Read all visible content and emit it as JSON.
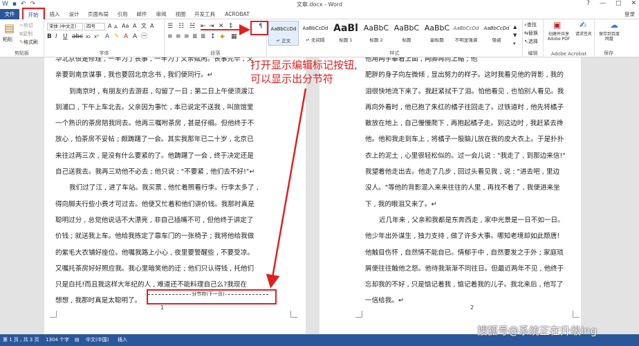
{
  "window": {
    "title": "文章.docx - Word",
    "controls": [
      "?",
      "—",
      "□",
      "✕"
    ]
  },
  "tabs": {
    "file": "文件",
    "items": [
      "开始",
      "插入",
      "设计",
      "页面布局",
      "引用",
      "邮件",
      "审阅",
      "视图",
      "开发工具",
      "ACROBAT"
    ],
    "active_index": 0,
    "login": "登录"
  },
  "ribbon": {
    "clipboard": {
      "paste": "粘贴",
      "cut": "剪切",
      "copy": "复制",
      "format_painter": "格式刷",
      "label": "剪贴板"
    },
    "font": {
      "family": "宋体 (中文正)",
      "size": "四号",
      "label": "字体"
    },
    "paragraph": {
      "label": "段落",
      "show_marks_icon": "pilcrow-icon"
    },
    "styles": {
      "label": "样式",
      "items": [
        {
          "preview": "AaBbCcDd",
          "label": "↵ 正文"
        },
        {
          "preview": "AaBbCcDd",
          "label": "↵ 无间隔"
        },
        {
          "preview": "AaBl",
          "label": "标题 1"
        },
        {
          "preview": "AaBbC",
          "label": "标题 2"
        },
        {
          "preview": "AaBbC",
          "label": "标题"
        },
        {
          "preview": "AaBbC",
          "label": "副标题"
        },
        {
          "preview": "AaBbCcDd",
          "label": "不明显强调"
        },
        {
          "preview": "AaBbCcDd",
          "label": "强调"
        }
      ]
    },
    "editing": {
      "find": "查找",
      "replace": "替换",
      "select": "选择",
      "label": "编辑"
    },
    "acrobat": {
      "create": "创建并共享 Adobe PDF",
      "request": "请求签名",
      "label": "Adobe Acrobat"
    },
    "save": {
      "button": "保存到百度网盘",
      "label": "保存"
    }
  },
  "annotation": {
    "line1": "打开显示编辑标记按钮,",
    "line2": "可以显示出分节符"
  },
  "document": {
    "page1": {
      "lines": [
        {
          "text": "华北京很是修理 , 一半为了丧事 , 一半为了父亲赋闲。丧事完毕 , 父",
          "indent": false
        },
        {
          "text": "亲要到南京谋事 , 我也要回北京念书 , 我们便同行。↵",
          "indent": false
        },
        {
          "text": "到南京时 , 有朋友约去游逛 , 勾留了一日 ; 第二日上午便须渡江",
          "indent": true
        },
        {
          "text": "到浦口 , 下午上车北去。父亲因为事忙 , 本已说定不送我 , 叫旅馆里",
          "indent": false
        },
        {
          "text": "一个熟识的茶房陪我同去。他再三嘱咐茶房 , 甚是仔细。但他终于不",
          "indent": false
        },
        {
          "text": "放心 , 怕茶房不妥帖 ; 颇踌躇了一会。其实我那年已二十岁 , 北京已",
          "indent": false
        },
        {
          "text": "来往过两三次 , 是没有什么要紧的了。他踌躇了一会 , 终于决定还是",
          "indent": false
        },
        {
          "text": "自己送我去。我再三劝他不必去 ; 他只说 : \"不要紧 , 他们去不好!\"↵",
          "indent": false
        },
        {
          "text": "我们过了江 , 进了车站。我买票 , 他忙着照看行李。行李太多了 ,",
          "indent": true
        },
        {
          "text": "得向脚夫行些小费才可过去。他便又忙着和他们讲价钱。我那时真是",
          "indent": false
        },
        {
          "text": "聪明过分 , 总觉他说话不大漂亮 , 非自己插嘴不可 , 但他终于讲定了",
          "indent": false
        },
        {
          "text": "价钱 ; 就送我上车。他给我拣定了靠车门的一张椅子 ; 我将他给我做",
          "indent": false
        },
        {
          "text": "的紫毛大衣铺好座位。他嘱我路上小心 , 夜里要警醒些 , 不要受凉。",
          "indent": false
        },
        {
          "text": "又嘱托茶房好好照应我。我心里暗笑他的迂 ; 他们只认得钱 , 托他们",
          "indent": false
        },
        {
          "text": "只是白托!而且我这样大年纪的人 , 难道还不能料理自己么?我现在",
          "indent": false
        },
        {
          "text": "想想 , 我那时真是太聪明了。",
          "indent": false
        }
      ],
      "section_break": "分节符(下一页)",
      "page_number": "1"
    },
    "page2": {
      "lines": [
        {
          "text": "他用两手攀着上面 , 两脚再向上缩 ; 他",
          "indent": false
        },
        {
          "text": "肥胖的身子向左微倾 , 显出努力的样子。这时我看见他的背影 , 我的",
          "indent": false
        },
        {
          "text": "泪很快地流下来了。我赶紧拭干了泪。怕他看见 , 也怕别人看见。我",
          "indent": false
        },
        {
          "text": "再向外看时 , 他已抱了朱红的橘子往回走了。过铁道时 , 他先将橘子",
          "indent": false
        },
        {
          "text": "散放在地上 , 自己慢慢爬下 , 再抱起橘子走。到这边时 , 我赶紧去搀",
          "indent": false
        },
        {
          "text": "他。他和我走到车上 , 将橘子一股脑儿放在我的皮大衣上。于是扑扑",
          "indent": false
        },
        {
          "text": "衣上的泥土 , 心里很轻松似的。过一会儿说 : \"我走了 , 到那边来信!\"",
          "indent": false
        },
        {
          "text": "我望着他走出去。他走了几步 , 回过头看见我 , 说 : \"进去吧 , 里边",
          "indent": false
        },
        {
          "text": "没人。\"等他的背影混入来来往往的人里 , 再找不着了 , 我便进来坐",
          "indent": false
        },
        {
          "text": "下 , 我的眼泪又来了。↵",
          "indent": false
        },
        {
          "text": "近几年来 , 父亲和我都是东奔西走 , 家中光景是一日不如一日。",
          "indent": true
        },
        {
          "text": "他少年出外谋生 , 独力支持 , 做了许多大事。哪知老境却如此颓唐!",
          "indent": false
        },
        {
          "text": "他触目伤怀 , 自然情不能自已。情郁于中 , 自然要发之于外 ; 家庭琐",
          "indent": false
        },
        {
          "text": "屑便往往触他之怒。他待我渐渐不同往日。但最近两年不见 , 他终于",
          "indent": false
        },
        {
          "text": "忘却我的不好 , 只是惦记着我 , 惦记着我的儿子。我北来后 , 他写了",
          "indent": false
        },
        {
          "text": "一信给我。↵",
          "indent": false
        }
      ],
      "page_number": "2"
    }
  },
  "status": {
    "page": "第 1 页 , 共 3 页",
    "words": "1304 个字",
    "language": "中文(中国)",
    "mode": "插入"
  },
  "watermark": "搜狐号@系统正在升级ing",
  "colors": {
    "accent": "#2b579a",
    "annotation": "#e02020"
  }
}
